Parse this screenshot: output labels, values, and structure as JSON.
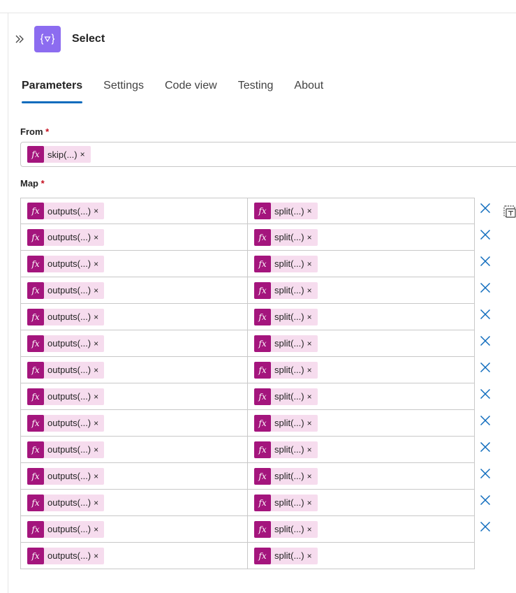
{
  "action": {
    "title": "Select",
    "icon": "select-data-operation-icon"
  },
  "tabs": [
    {
      "label": "Parameters",
      "active": true
    },
    {
      "label": "Settings",
      "active": false
    },
    {
      "label": "Code view",
      "active": false
    },
    {
      "label": "Testing",
      "active": false
    },
    {
      "label": "About",
      "active": false
    }
  ],
  "from": {
    "label": "From",
    "required_mark": "*",
    "token": {
      "icon": "fx-icon",
      "fx": "fx",
      "label": "skip(...)",
      "remove": "×"
    }
  },
  "map": {
    "label": "Map",
    "required_mark": "*",
    "rows": [
      {
        "key": "outputs(...)",
        "value": "split(...)",
        "deletable": true
      },
      {
        "key": "outputs(...)",
        "value": "split(...)",
        "deletable": true
      },
      {
        "key": "outputs(...)",
        "value": "split(...)",
        "deletable": true
      },
      {
        "key": "outputs(...)",
        "value": "split(...)",
        "deletable": true
      },
      {
        "key": "outputs(...)",
        "value": "split(...)",
        "deletable": true
      },
      {
        "key": "outputs(...)",
        "value": "split(...)",
        "deletable": true
      },
      {
        "key": "outputs(...)",
        "value": "split(...)",
        "deletable": true
      },
      {
        "key": "outputs(...)",
        "value": "split(...)",
        "deletable": true
      },
      {
        "key": "outputs(...)",
        "value": "split(...)",
        "deletable": true
      },
      {
        "key": "outputs(...)",
        "value": "split(...)",
        "deletable": true
      },
      {
        "key": "outputs(...)",
        "value": "split(...)",
        "deletable": true
      },
      {
        "key": "outputs(...)",
        "value": "split(...)",
        "deletable": true
      },
      {
        "key": "outputs(...)",
        "value": "split(...)",
        "deletable": true
      },
      {
        "key": "outputs(...)",
        "value": "split(...)",
        "deletable": false
      }
    ],
    "token_fx": "fx",
    "token_remove": "×"
  },
  "icons": {
    "expand": "double-chevron-right-icon",
    "delete_row": "close-icon",
    "switch_mode": "switch-to-text-mode-icon"
  },
  "colors": {
    "action_icon_bg": "#8c6cf0",
    "fx_badge": "#a4157d",
    "token_bg": "#f6dcee",
    "tab_indicator": "#0f6cbd",
    "delete_icon": "#0f6cbd",
    "required": "#c50f1f"
  }
}
